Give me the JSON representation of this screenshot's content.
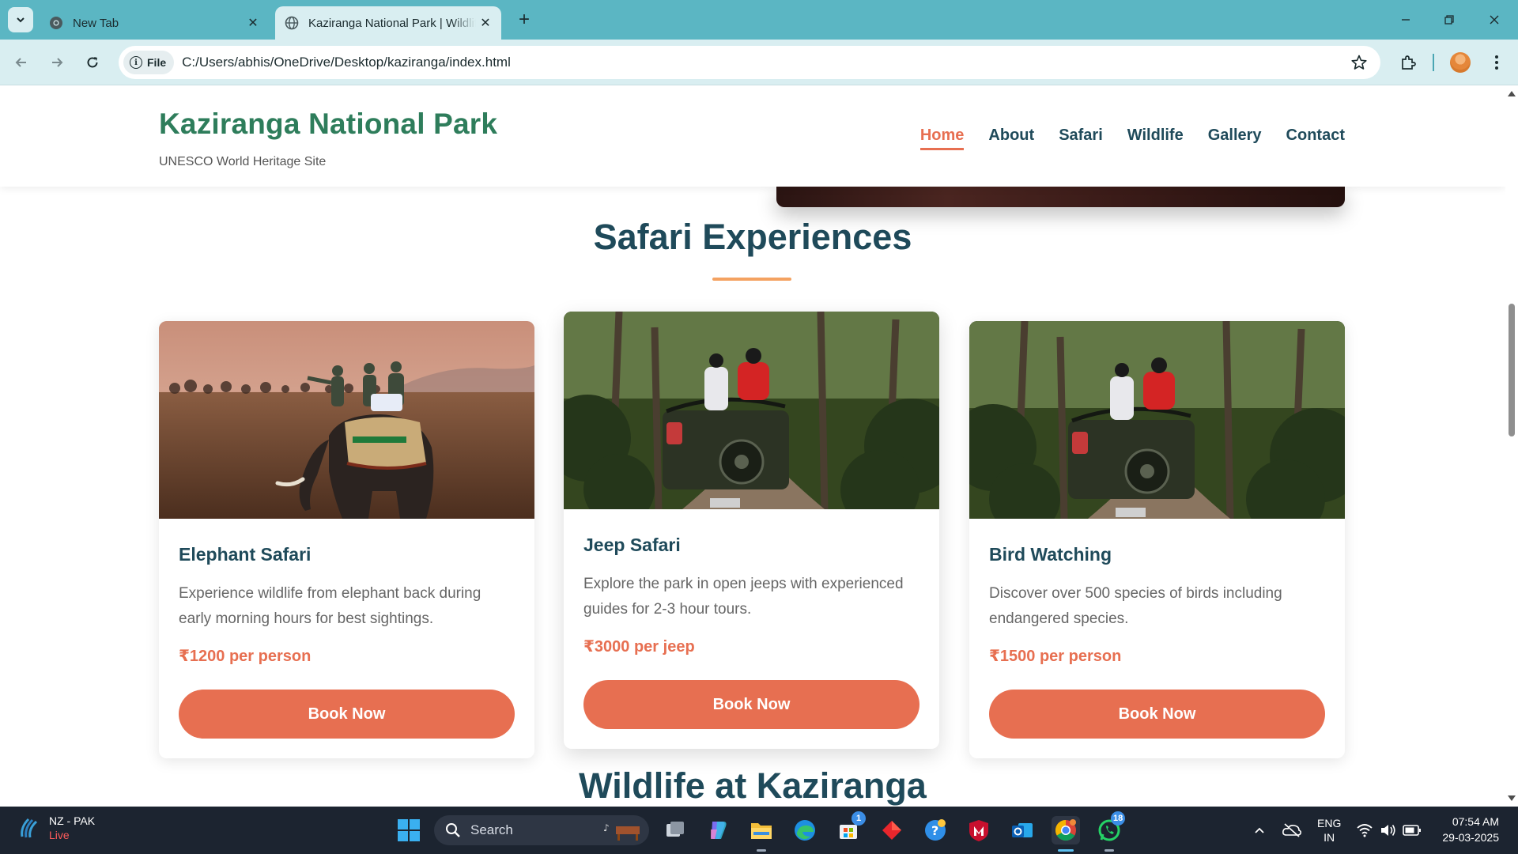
{
  "browser": {
    "tabs": [
      {
        "title": "New Tab",
        "active": false
      },
      {
        "title": "Kaziranga National Park | Wildlife",
        "active": true
      }
    ],
    "site_chip": "File",
    "url": "C:/Users/abhis/OneDrive/Desktop/kaziranga/index.html"
  },
  "site": {
    "logo_title": "Kaziranga National Park",
    "logo_subtitle": "UNESCO World Heritage Site",
    "nav": [
      {
        "label": "Home",
        "active": true
      },
      {
        "label": "About",
        "active": false
      },
      {
        "label": "Safari",
        "active": false
      },
      {
        "label": "Wildlife",
        "active": false
      },
      {
        "label": "Gallery",
        "active": false
      },
      {
        "label": "Contact",
        "active": false
      }
    ]
  },
  "safari": {
    "title": "Safari Experiences",
    "cards": [
      {
        "title": "Elephant Safari",
        "description": "Experience wildlife from elephant back during early morning hours for best sightings.",
        "price": "₹1200 per person",
        "button": "Book Now"
      },
      {
        "title": "Jeep Safari",
        "description": "Explore the park in open jeeps with experienced guides for 2-3 hour tours.",
        "price": "₹3000 per jeep",
        "button": "Book Now"
      },
      {
        "title": "Bird Watching",
        "description": "Discover over 500 species of birds including endangered species.",
        "price": "₹1500 per person",
        "button": "Book Now"
      }
    ]
  },
  "wildlife": {
    "title": "Wildlife at Kaziranga"
  },
  "taskbar": {
    "weather_line1": "NZ - PAK",
    "weather_line2": "Live",
    "search_placeholder": "Search",
    "badges": {
      "store": "1",
      "whatsapp": "18"
    },
    "lang_line1": "ENG",
    "lang_line2": "IN",
    "time": "07:54 AM",
    "date": "29-03-2025"
  },
  "colors": {
    "accent": "#e76f51",
    "heading": "#1f4a5a",
    "logo": "#2e7d5b",
    "underline": "#f4a261",
    "tabbar": "#5bb6c3"
  }
}
